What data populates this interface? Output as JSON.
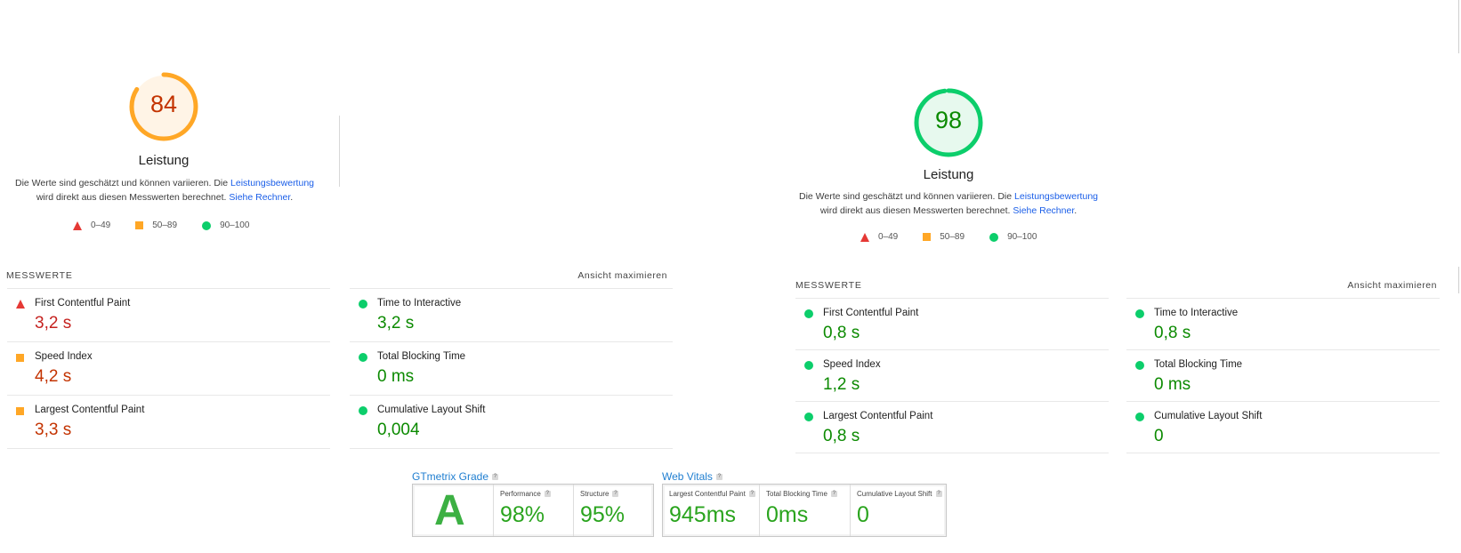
{
  "legend": {
    "low": "0–49",
    "mid": "50–89",
    "high": "90–100"
  },
  "left": {
    "score": "84",
    "score_value": 84,
    "label": "Leistung",
    "desc_line1_pre": "Die Werte sind geschätzt und können variieren. Die ",
    "desc_line1_link": "Leistungsbewertung",
    "desc_line2_pre": "wird direkt aus diesen Messwerten berechnet. ",
    "desc_line2_link": "Siehe Rechner",
    "desc_line2_post": ".",
    "section_title": "MESSWERTE",
    "expand_link": "Ansicht maximieren",
    "metrics": [
      {
        "name": "First Contentful Paint",
        "value": "3,2 s",
        "status": "fail"
      },
      {
        "name": "Time to Interactive",
        "value": "3,2 s",
        "status": "pass"
      },
      {
        "name": "Speed Index",
        "value": "4,2 s",
        "status": "average"
      },
      {
        "name": "Total Blocking Time",
        "value": "0 ms",
        "status": "pass"
      },
      {
        "name": "Largest Contentful Paint",
        "value": "3,3 s",
        "status": "average"
      },
      {
        "name": "Cumulative Layout Shift",
        "value": "0,004",
        "status": "pass"
      }
    ]
  },
  "right": {
    "score": "98",
    "score_value": 98,
    "label": "Leistung",
    "desc_line1_pre": "Die Werte sind geschätzt und können variieren. Die ",
    "desc_line1_link": "Leistungsbewertung",
    "desc_line2_pre": "wird direkt aus diesen Messwerten berechnet. ",
    "desc_line2_link": "Siehe Rechner",
    "desc_line2_post": ".",
    "section_title": "MESSWERTE",
    "expand_link": "Ansicht maximieren",
    "metrics": [
      {
        "name": "First Contentful Paint",
        "value": "0,8 s",
        "status": "pass"
      },
      {
        "name": "Time to Interactive",
        "value": "0,8 s",
        "status": "pass"
      },
      {
        "name": "Speed Index",
        "value": "1,2 s",
        "status": "pass"
      },
      {
        "name": "Total Blocking Time",
        "value": "0 ms",
        "status": "pass"
      },
      {
        "name": "Largest Contentful Paint",
        "value": "0,8 s",
        "status": "pass"
      },
      {
        "name": "Cumulative Layout Shift",
        "value": "0",
        "status": "pass"
      }
    ]
  },
  "gtmetrix": {
    "grade_title": "GTmetrix Grade",
    "grade": "A",
    "performance_label": "Performance",
    "performance_value": "98%",
    "structure_label": "Structure",
    "structure_value": "95%",
    "vitals_title": "Web Vitals",
    "lcp_label": "Largest Contentful Paint",
    "lcp_value": "945ms",
    "tbt_label": "Total Blocking Time",
    "tbt_value": "0ms",
    "cls_label": "Cumulative Layout Shift",
    "cls_value": "0",
    "help_mark": "?"
  },
  "colors": {
    "fail": "#e53935",
    "average": "#ffa726",
    "pass": "#0cce6b",
    "link": "#1a5ee8"
  }
}
